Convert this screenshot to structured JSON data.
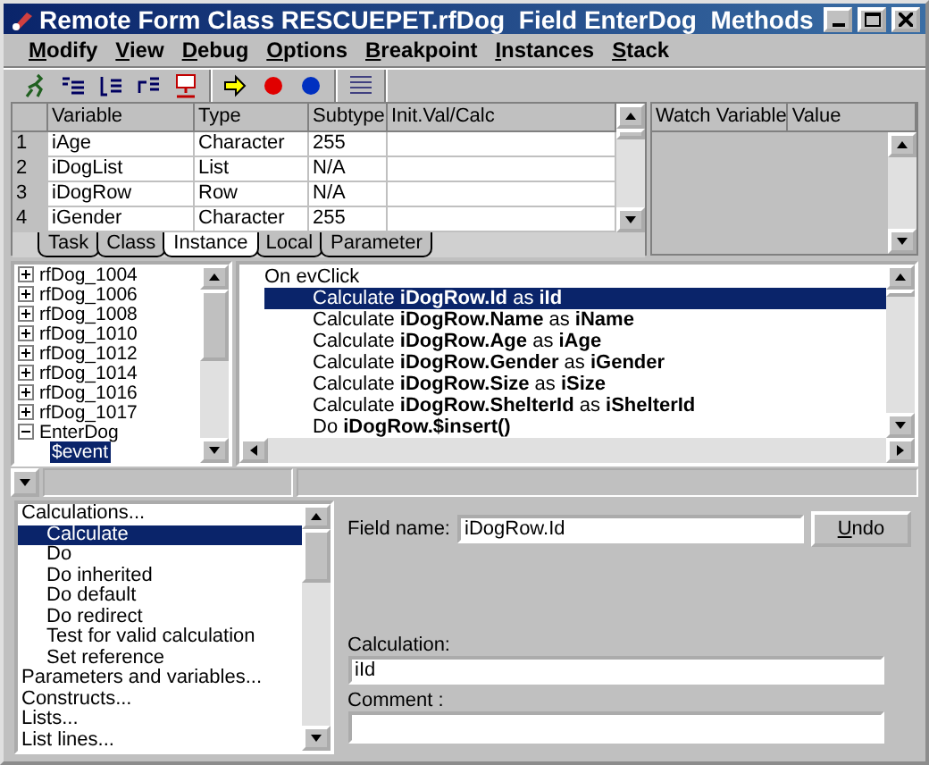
{
  "window": {
    "title": "Remote Form Class RESCUEPET.rfDog  Field EnterDog  Methods"
  },
  "menu": [
    "Modify",
    "View",
    "Debug",
    "Options",
    "Breakpoint",
    "Instances",
    "Stack"
  ],
  "variables": {
    "columns": [
      "Variable",
      "Type",
      "Subtype",
      "Init.Val/Calc"
    ],
    "rows": [
      {
        "number": "1",
        "variable": "iAge",
        "type": "Character",
        "subtype": "255"
      },
      {
        "number": "2",
        "variable": "iDogList",
        "type": "List",
        "subtype": "N/A"
      },
      {
        "number": "3",
        "variable": "iDogRow",
        "type": "Row",
        "subtype": "N/A"
      },
      {
        "number": "4",
        "variable": "iGender",
        "type": "Character",
        "subtype": "255"
      }
    ]
  },
  "tabs": [
    {
      "label": "Task",
      "selected": false
    },
    {
      "label": "Class",
      "selected": false
    },
    {
      "label": "Instance",
      "selected": true
    },
    {
      "label": "Local",
      "selected": false
    },
    {
      "label": "Parameter",
      "selected": false
    }
  ],
  "watch": {
    "columns": [
      "Watch Variable",
      "Value"
    ]
  },
  "tree": [
    {
      "label": "rfDog_1004",
      "expanded": false
    },
    {
      "label": "rfDog_1006",
      "expanded": false
    },
    {
      "label": "rfDog_1008",
      "expanded": false
    },
    {
      "label": "rfDog_1010",
      "expanded": false
    },
    {
      "label": "rfDog_1012",
      "expanded": false
    },
    {
      "label": "rfDog_1014",
      "expanded": false
    },
    {
      "label": "rfDog_1016",
      "expanded": false
    },
    {
      "label": "rfDog_1017",
      "expanded": false
    },
    {
      "label": "EnterDog",
      "expanded": true,
      "children": [
        {
          "label": "$event",
          "selected": true
        }
      ]
    }
  ],
  "code": {
    "header": "On evClick",
    "lines": [
      {
        "text": "Calculate **iDogRow.Id** as **iId**",
        "selected": true
      },
      {
        "text": "Calculate **iDogRow.Name** as **iName**",
        "selected": false
      },
      {
        "text": "Calculate **iDogRow.Age** as **iAge**",
        "selected": false
      },
      {
        "text": "Calculate **iDogRow.Gender** as **iGender**",
        "selected": false
      },
      {
        "text": "Calculate **iDogRow.Size** as **iSize**",
        "selected": false
      },
      {
        "text": "Calculate **iDogRow.ShelterId** as **iShelterId**",
        "selected": false
      },
      {
        "text": "Do **iDogRow.$insert()**",
        "selected": false
      }
    ]
  },
  "commands": [
    {
      "label": "Calculations...",
      "selected": false,
      "children": [
        {
          "label": "Calculate",
          "selected": true
        },
        {
          "label": "Do",
          "selected": false
        },
        {
          "label": "Do inherited",
          "selected": false
        },
        {
          "label": "Do default",
          "selected": false
        },
        {
          "label": "Do redirect",
          "selected": false
        },
        {
          "label": "Test for valid calculation",
          "selected": false
        },
        {
          "label": "Set reference",
          "selected": false
        }
      ]
    },
    {
      "label": "Parameters and variables...",
      "selected": false
    },
    {
      "label": "Constructs...",
      "selected": false
    },
    {
      "label": "Lists...",
      "selected": false
    },
    {
      "label": "List lines...",
      "selected": false
    }
  ],
  "field_name": {
    "label": "Field name:",
    "value": "iDogRow.Id"
  },
  "undo_button": "Undo",
  "calculation": {
    "label": "Calculation:",
    "value": "iId"
  },
  "comment": {
    "label": "Comment :"
  }
}
